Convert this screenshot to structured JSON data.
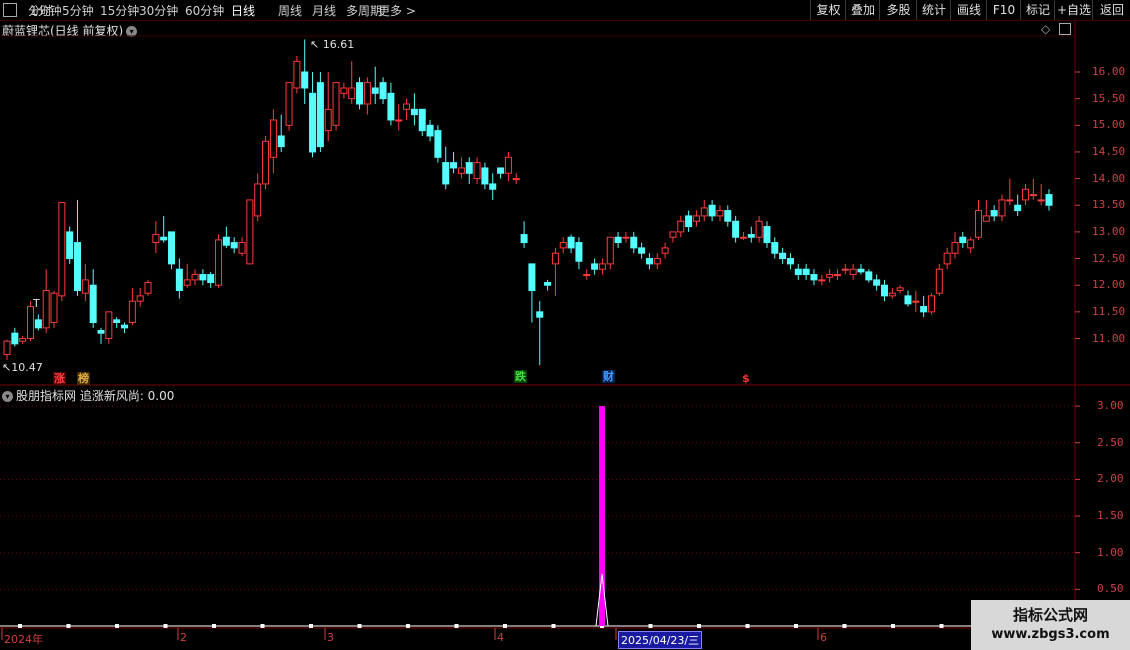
{
  "toolbar": {
    "left_items": [
      "分时",
      "1分钟",
      "5分钟",
      "15分钟",
      "30分钟",
      "60分钟",
      "日线",
      "周线",
      "月线",
      "多周期",
      "更多"
    ],
    "active": "日线",
    "right_items": [
      "复权",
      "叠加",
      "多股",
      "统计",
      "画线",
      "F10",
      "标记",
      "+自选",
      "返回"
    ]
  },
  "main_panel": {
    "title": "蔚蓝锂芯(日线 前复权)",
    "high_label": "16.61",
    "low_label": "10.47",
    "price_axis": [
      "16.00",
      "15.50",
      "15.00",
      "14.50",
      "14.00",
      "13.50",
      "13.00",
      "12.50",
      "12.00",
      "11.50",
      "11.00"
    ],
    "markers": [
      {
        "text": "涨",
        "color": "#ff4040",
        "bg": "#500000"
      },
      {
        "text": "榜",
        "color": "#e0b040",
        "bg": "#402800"
      },
      {
        "text": "跌",
        "color": "#40e040",
        "bg": "#004000"
      },
      {
        "text": "财",
        "color": "#40a0ff",
        "bg": "#002050"
      },
      {
        "text": "$",
        "color": "#ff3030",
        "bg": "transparent"
      }
    ]
  },
  "indicator_panel": {
    "title": "股朋指标网 追涨新风尚: 0.00",
    "axis": [
      "3.00",
      "2.50",
      "2.00",
      "1.50",
      "1.00",
      "0.50"
    ]
  },
  "date_axis": {
    "labels": [
      "2024年",
      "2",
      "3",
      "4",
      "2025/04/23/三",
      "6"
    ]
  },
  "colors": {
    "up": "#ff3b3b",
    "down": "#54ffff",
    "indicator": "#ff00ff",
    "grid": "#7a0000"
  },
  "watermark": {
    "line1": "指标公式网",
    "line2": "www.zbgs3.com"
  },
  "chart_data": {
    "type": "candlestick",
    "ylim": [
      10.3,
      17.0
    ],
    "candles": [
      [
        10.7,
        10.95,
        10.6,
        10.98
      ],
      [
        11.1,
        10.9,
        10.85,
        11.2
      ],
      [
        10.95,
        11.0,
        10.9,
        11.05
      ],
      [
        11.0,
        11.6,
        10.95,
        11.7
      ],
      [
        11.35,
        11.2,
        11.15,
        11.45
      ],
      [
        11.2,
        11.9,
        11.1,
        12.3
      ],
      [
        11.3,
        11.85,
        11.2,
        11.9
      ],
      [
        11.8,
        13.55,
        11.7,
        13.55
      ],
      [
        13.0,
        12.5,
        12.4,
        13.1
      ],
      [
        12.8,
        11.9,
        11.8,
        13.6
      ],
      [
        11.85,
        12.1,
        11.7,
        12.4
      ],
      [
        12.0,
        11.3,
        11.2,
        12.3
      ],
      [
        11.15,
        11.1,
        10.9,
        11.2
      ],
      [
        11.0,
        11.5,
        10.9,
        11.5
      ],
      [
        11.35,
        11.3,
        11.2,
        11.4
      ],
      [
        11.25,
        11.2,
        11.1,
        11.3
      ],
      [
        11.3,
        11.7,
        11.25,
        11.95
      ],
      [
        11.7,
        11.8,
        11.6,
        11.95
      ],
      [
        11.85,
        12.05,
        11.8,
        12.1
      ],
      [
        12.8,
        12.95,
        12.6,
        13.2
      ],
      [
        12.9,
        12.85,
        12.8,
        13.3
      ],
      [
        13.0,
        12.4,
        12.3,
        13.0
      ],
      [
        12.3,
        11.9,
        11.75,
        12.5
      ],
      [
        12.0,
        12.1,
        11.95,
        12.4
      ],
      [
        12.1,
        12.2,
        12.0,
        12.3
      ],
      [
        12.2,
        12.1,
        12.0,
        12.3
      ],
      [
        12.2,
        12.05,
        11.95,
        12.25
      ],
      [
        12.0,
        12.85,
        11.95,
        12.95
      ],
      [
        12.9,
        12.75,
        12.7,
        13.1
      ],
      [
        12.8,
        12.7,
        12.6,
        12.9
      ],
      [
        12.6,
        12.8,
        12.55,
        12.9
      ],
      [
        12.4,
        13.6,
        12.4,
        13.6
      ],
      [
        13.3,
        13.9,
        13.2,
        14.1
      ],
      [
        13.9,
        14.7,
        13.8,
        14.8
      ],
      [
        14.4,
        15.1,
        14.1,
        15.3
      ],
      [
        14.8,
        14.6,
        14.5,
        15.2
      ],
      [
        15.0,
        15.8,
        14.9,
        15.8
      ],
      [
        15.7,
        16.2,
        15.6,
        16.3
      ],
      [
        16.0,
        15.7,
        15.4,
        16.61
      ],
      [
        15.6,
        14.5,
        14.4,
        16.0
      ],
      [
        15.8,
        14.6,
        14.5,
        16.0
      ],
      [
        14.9,
        15.3,
        14.7,
        16.0
      ],
      [
        15.0,
        15.8,
        14.9,
        15.8
      ],
      [
        15.6,
        15.7,
        15.5,
        15.8
      ],
      [
        15.5,
        15.7,
        15.4,
        16.2
      ],
      [
        15.8,
        15.4,
        15.3,
        15.9
      ],
      [
        15.4,
        15.8,
        15.2,
        15.9
      ],
      [
        15.7,
        15.6,
        15.4,
        16.1
      ],
      [
        15.8,
        15.5,
        15.4,
        15.9
      ],
      [
        15.6,
        15.1,
        15.0,
        15.8
      ],
      [
        15.1,
        15.1,
        14.9,
        15.4
      ],
      [
        15.3,
        15.4,
        15.1,
        15.5
      ],
      [
        15.3,
        15.2,
        15.0,
        15.6
      ],
      [
        15.3,
        14.9,
        14.8,
        15.3
      ],
      [
        15.0,
        14.8,
        14.7,
        15.1
      ],
      [
        14.9,
        14.4,
        14.3,
        15.0
      ],
      [
        14.3,
        13.9,
        13.8,
        14.6
      ],
      [
        14.3,
        14.2,
        14.1,
        14.5
      ],
      [
        14.1,
        14.2,
        14.0,
        14.4
      ],
      [
        14.3,
        14.1,
        13.9,
        14.4
      ],
      [
        14.0,
        14.3,
        13.9,
        14.4
      ],
      [
        14.2,
        13.9,
        13.8,
        14.3
      ],
      [
        13.9,
        13.8,
        13.6,
        14.1
      ],
      [
        14.2,
        14.1,
        14.0,
        14.2
      ],
      [
        14.1,
        14.4,
        13.95,
        14.5
      ],
      [
        14.0,
        14.0,
        13.9,
        14.1
      ],
      [
        12.95,
        12.8,
        12.7,
        13.2
      ],
      [
        12.4,
        11.9,
        11.3,
        12.4
      ],
      [
        11.5,
        11.4,
        10.5,
        11.7
      ],
      [
        12.05,
        12.0,
        11.9,
        12.1
      ],
      [
        12.4,
        12.6,
        11.8,
        12.7
      ],
      [
        12.7,
        12.8,
        12.6,
        12.9
      ],
      [
        12.9,
        12.7,
        12.6,
        12.95
      ],
      [
        12.8,
        12.45,
        12.3,
        12.9
      ],
      [
        12.2,
        12.2,
        12.1,
        12.3
      ],
      [
        12.4,
        12.3,
        12.2,
        12.5
      ],
      [
        12.3,
        12.4,
        12.2,
        12.5
      ],
      [
        12.4,
        12.9,
        12.3,
        12.9
      ],
      [
        12.9,
        12.8,
        12.7,
        13.0
      ],
      [
        12.9,
        12.9,
        12.8,
        13.0
      ],
      [
        12.9,
        12.7,
        12.6,
        13.0
      ],
      [
        12.7,
        12.6,
        12.5,
        12.8
      ],
      [
        12.5,
        12.4,
        12.3,
        12.6
      ],
      [
        12.4,
        12.5,
        12.3,
        12.6
      ],
      [
        12.6,
        12.7,
        12.5,
        12.8
      ],
      [
        12.9,
        13.0,
        12.8,
        13.0
      ],
      [
        13.0,
        13.2,
        12.9,
        13.3
      ],
      [
        13.3,
        13.1,
        13.0,
        13.4
      ],
      [
        13.2,
        13.3,
        13.1,
        13.4
      ],
      [
        13.3,
        13.45,
        13.2,
        13.6
      ],
      [
        13.5,
        13.3,
        13.2,
        13.6
      ],
      [
        13.3,
        13.4,
        13.2,
        13.5
      ],
      [
        13.4,
        13.2,
        13.1,
        13.5
      ],
      [
        13.2,
        12.9,
        12.8,
        13.3
      ],
      [
        12.9,
        12.9,
        12.85,
        13.0
      ],
      [
        12.95,
        12.9,
        12.8,
        13.1
      ],
      [
        12.9,
        13.2,
        12.8,
        13.3
      ],
      [
        13.1,
        12.8,
        12.7,
        13.2
      ],
      [
        12.8,
        12.6,
        12.5,
        12.9
      ],
      [
        12.6,
        12.5,
        12.4,
        12.7
      ],
      [
        12.5,
        12.4,
        12.3,
        12.6
      ],
      [
        12.3,
        12.2,
        12.1,
        12.4
      ],
      [
        12.3,
        12.2,
        12.1,
        12.4
      ],
      [
        12.2,
        12.1,
        12.0,
        12.3
      ],
      [
        12.1,
        12.1,
        12.0,
        12.2
      ],
      [
        12.15,
        12.2,
        12.05,
        12.3
      ],
      [
        12.2,
        12.2,
        12.1,
        12.3
      ],
      [
        12.3,
        12.3,
        12.2,
        12.4
      ],
      [
        12.2,
        12.3,
        12.1,
        12.4
      ],
      [
        12.3,
        12.25,
        12.2,
        12.4
      ],
      [
        12.25,
        12.1,
        12.05,
        12.3
      ],
      [
        12.1,
        12.0,
        11.9,
        12.2
      ],
      [
        12.0,
        11.8,
        11.7,
        12.1
      ],
      [
        11.8,
        11.85,
        11.75,
        11.95
      ],
      [
        11.9,
        11.95,
        11.85,
        12.0
      ],
      [
        11.8,
        11.65,
        11.6,
        11.9
      ],
      [
        11.7,
        11.7,
        11.5,
        11.9
      ],
      [
        11.6,
        11.5,
        11.4,
        11.8
      ],
      [
        11.5,
        11.8,
        11.45,
        11.85
      ],
      [
        11.85,
        12.3,
        11.8,
        12.4
      ],
      [
        12.4,
        12.6,
        12.3,
        12.7
      ],
      [
        12.6,
        12.8,
        12.5,
        13.0
      ],
      [
        12.9,
        12.8,
        12.7,
        13.0
      ],
      [
        12.7,
        12.85,
        12.6,
        12.9
      ],
      [
        12.9,
        13.4,
        12.85,
        13.6
      ],
      [
        13.2,
        13.3,
        13.2,
        13.6
      ],
      [
        13.4,
        13.3,
        13.2,
        13.5
      ],
      [
        13.3,
        13.6,
        13.2,
        13.7
      ],
      [
        13.6,
        13.6,
        13.5,
        14.0
      ],
      [
        13.5,
        13.4,
        13.3,
        13.7
      ],
      [
        13.6,
        13.8,
        13.5,
        13.9
      ],
      [
        13.7,
        13.7,
        13.6,
        14.0
      ],
      [
        13.6,
        13.6,
        13.5,
        13.9
      ],
      [
        13.7,
        13.5,
        13.4,
        13.8
      ]
    ],
    "indicator": {
      "name": "追涨新风尚",
      "spike_date": "2025/04/23",
      "spike_value": 3.0,
      "baseline_value": 0.0
    }
  }
}
